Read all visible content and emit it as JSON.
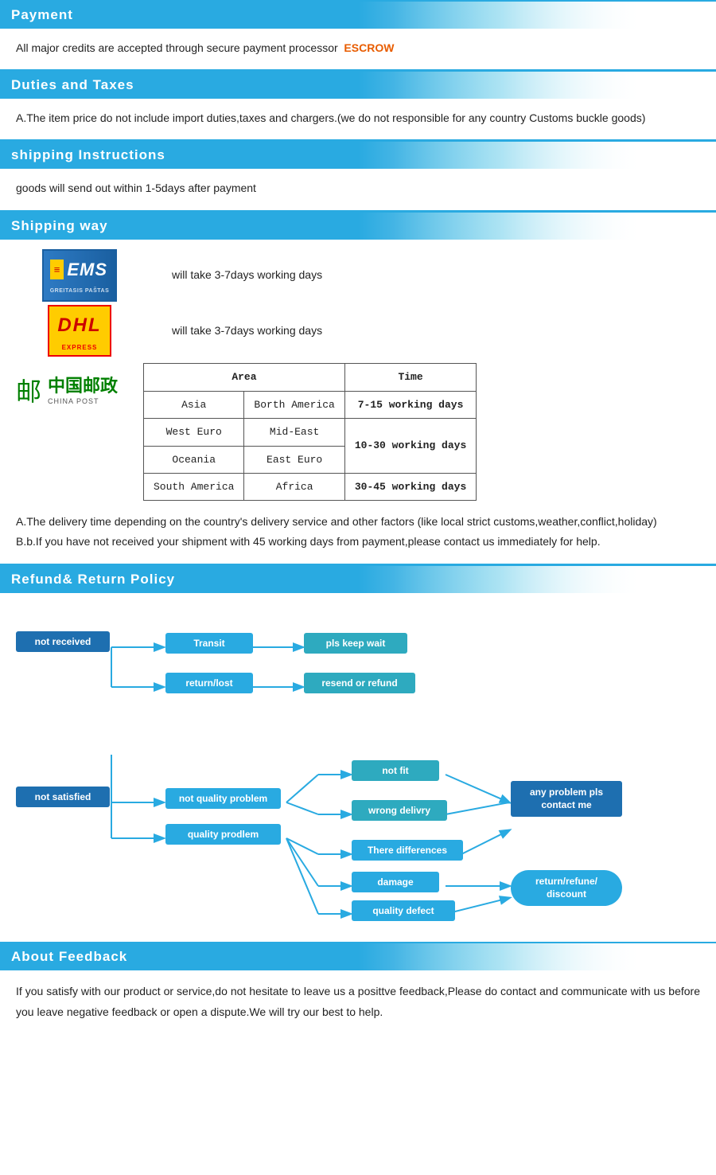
{
  "payment": {
    "header": "Payment",
    "text": "All  major  credits  are  accepted  through  secure  payment  processor",
    "escrow": "ESCROW"
  },
  "duties": {
    "header": "Duties  and  Taxes",
    "text": "A.The  item  price  do  not  include  import  duties,taxes  and  chargers.(we  do  not  responsible  for  any  country  Customs  buckle  goods)"
  },
  "shipping_instructions": {
    "header": "shipping  Instructions",
    "text": "goods  will  send  out  within  1-5days  after  payment"
  },
  "shipping_way": {
    "header": "Shipping  way",
    "ems_text": "will  take  3-7days  working  days",
    "dhl_text": "will  take  3-7days  working  days",
    "table": {
      "col1": "Area",
      "col2": "Time",
      "rows": [
        {
          "area1": "Asia",
          "area2": "Borth America",
          "time": "7-15 working days"
        },
        {
          "area1": "West Euro",
          "area2": "Mid-East",
          "time": ""
        },
        {
          "area1": "Oceania",
          "area2": "East Euro",
          "time": "10-30 working days"
        },
        {
          "area1": "South America",
          "area2": "Africa",
          "time": "30-45 working days"
        }
      ]
    },
    "note_a": "A.The  delivery  time  depending  on  the  country's  delivery  service  and  other  factors  (like  local  strict  customs,weather,conflict,holiday)",
    "note_b": "B.b.If  you  have  not  received  your  shipment  with  45  working  days  from  payment,please  contact  us  immediately  for  help."
  },
  "refund": {
    "header": "Refund&  Return  Policy",
    "boxes": {
      "not_received": "not  received",
      "transit": "Transit",
      "return_lost": "return/lost",
      "pls_keep_wait": "pls  keep  wait",
      "resend_or_refund": "resend  or  refund",
      "not_satisfied": "not  satisfied",
      "not_quality_problem": "not  quality  problem",
      "not_fit": "not  fit",
      "wrong_delivry": "wrong  delivry",
      "there_differences": "There  differences",
      "quality_prodlem": "quality  prodlem",
      "damage": "damage",
      "quality_defect": "quality  defect",
      "any_problem": "any  problem  pls contact  me",
      "return_refune": "return/refune/ discount"
    }
  },
  "feedback": {
    "header": "About  Feedback",
    "text": "If  you  satisfy  with  our  product  or  service,do  not  hesitate  to  leave  us  a  posittve  feedback,Please  do  contact  and  communicate  with  us  before  you  leave  negative  feedback  or  open  a  dispute.We  will  try  our  best  to  help."
  }
}
